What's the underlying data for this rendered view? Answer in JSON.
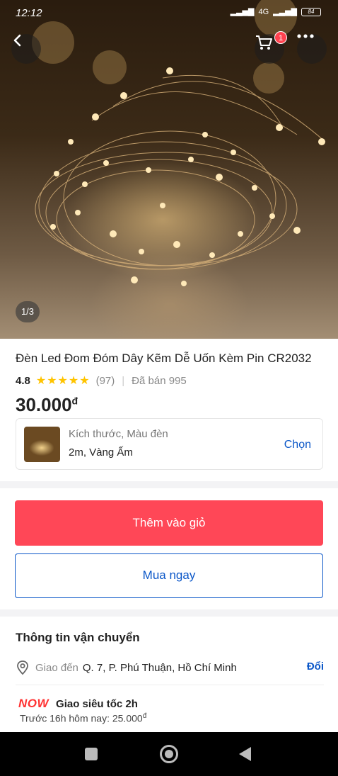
{
  "status_bar": {
    "time": "12:12",
    "network": "4G",
    "battery": "84"
  },
  "header": {
    "cart_count": "1",
    "image_counter": "1/3"
  },
  "product": {
    "title": "Đèn Led Đom Đóm Dây Kẽm Dễ Uốn Kèm Pin CR2032",
    "rating": "4.8",
    "stars": "★★★★★",
    "review_count": "(97)",
    "separator": "|",
    "sold": "Đã bán 995",
    "price": "30.000",
    "currency": "đ"
  },
  "variant": {
    "label": "Kích thước, Màu đèn",
    "value": "2m, Vàng Ấm",
    "choose": "Chọn"
  },
  "actions": {
    "add_to_cart": "Thêm vào giỏ",
    "buy_now": "Mua ngay"
  },
  "shipping": {
    "title": "Thông tin vận chuyển",
    "deliver_to": "Giao đến",
    "address": "Q. 7, P. Phú Thuận, Hồ Chí Minh",
    "change": "Đổi",
    "now_logo": "NOW",
    "now_title": "Giao siêu tốc 2h",
    "now_note": "Trước 16h hôm nay: 25.000",
    "now_currency": "đ"
  },
  "colors": {
    "primary_blue": "#0b57c8",
    "cart_red": "#ff4757",
    "star": "#ffc400"
  }
}
